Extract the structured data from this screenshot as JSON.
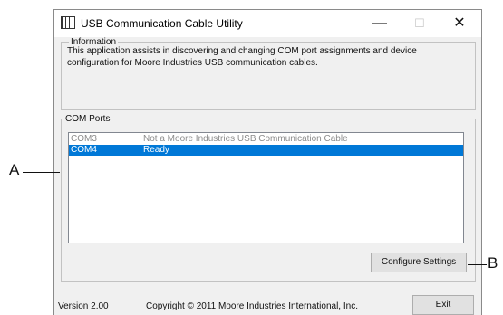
{
  "window": {
    "title": "USB Communication Cable Utility",
    "minimize_glyph": "—",
    "maximize_glyph": "☐",
    "close_glyph": "✕"
  },
  "information": {
    "legend": "Information",
    "text": "This application assists in discovering and changing COM port assignments and device configuration for Moore Industries USB communication cables."
  },
  "com_ports": {
    "legend": "COM Ports",
    "rows": [
      {
        "port": "COM3",
        "status": "Not a Moore Industries USB Communication Cable",
        "selected": false
      },
      {
        "port": "COM4",
        "status": "Ready",
        "selected": true
      }
    ],
    "configure_label": "Configure Settings"
  },
  "footer": {
    "version": "Version 2.00",
    "copyright": "Copyright © 2011 Moore Industries International, Inc.",
    "exit_label": "Exit"
  },
  "callouts": {
    "a": "A",
    "b": "B"
  },
  "colors": {
    "selection": "#0078d7",
    "dialog_bg": "#f0f0f0"
  }
}
